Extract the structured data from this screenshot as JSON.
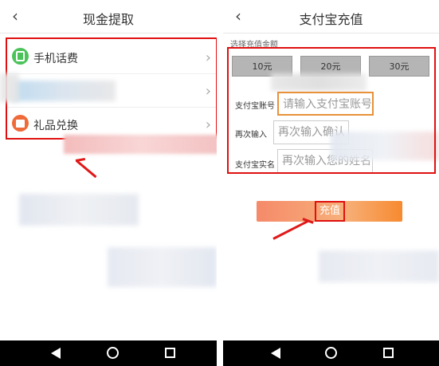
{
  "left_screen": {
    "title": "现金提取",
    "back_icon": "chevron-left-icon",
    "options": [
      {
        "label": "手机话费",
        "icon": "phone-icon",
        "icon_color": "#4cc35a"
      },
      {
        "label": "",
        "icon": "",
        "icon_color": "#9cc5e6"
      },
      {
        "label": "礼品兑换",
        "icon": "gift-icon",
        "icon_color": "#ef6b3a"
      }
    ]
  },
  "right_screen": {
    "title": "支付宝充值",
    "back_icon": "chevron-left-icon",
    "amount_section_label": "选择充值金额",
    "amounts": [
      "10元",
      "20元",
      "30元"
    ],
    "fields": [
      {
        "label": "支付宝账号",
        "placeholder": "请输入支付宝账号"
      },
      {
        "label": "再次输入",
        "placeholder": "再次输入确认"
      },
      {
        "label": "支付宝实名",
        "placeholder": "再次输入您的姓名"
      }
    ],
    "submit_label": "充值"
  },
  "colors": {
    "highlight_red": "#e01010",
    "button_orange": "#f78a30"
  }
}
